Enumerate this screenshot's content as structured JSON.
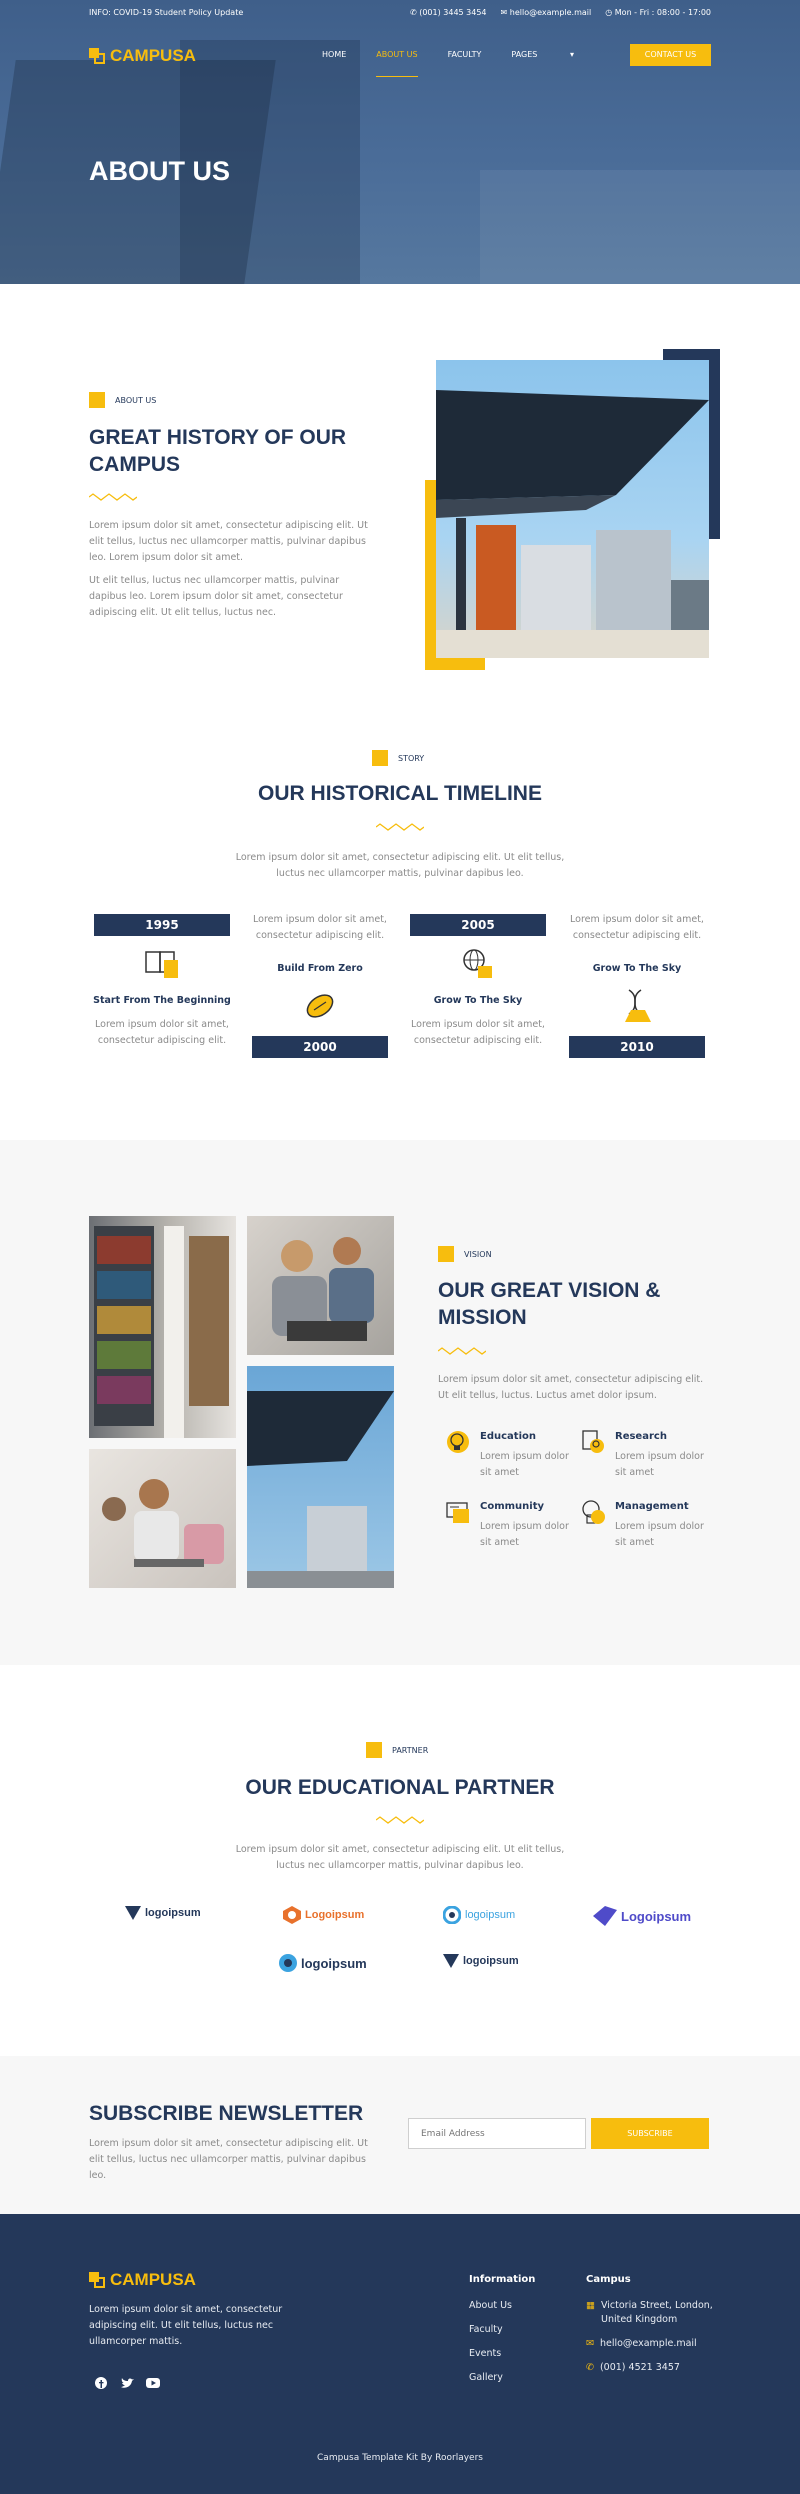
{
  "topbar": {
    "info": "INFO: COVID-19 Student Policy Update",
    "phone": "(001) 3445 3454",
    "email": "hello@example.mail",
    "hours": "Mon - Fri : 08:00 - 17:00"
  },
  "brand": {
    "name": "CAMPUSA",
    "accent": "#f7bd0e",
    "navy": "#24385a"
  },
  "nav": {
    "items": [
      "HOME",
      "ABOUT US",
      "FACULTY",
      "PAGES",
      "CONTACT US"
    ],
    "active": "ABOUT US",
    "cta": "CONTACT US"
  },
  "hero": {
    "title": "ABOUT US"
  },
  "about": {
    "tag": "ABOUT US",
    "title": "GREAT HISTORY OF OUR CAMPUS",
    "p1": "Lorem ipsum dolor sit amet, consectetur adipiscing elit. Ut elit tellus, luctus nec ullamcorper mattis, pulvinar dapibus leo. Lorem ipsum dolor sit amet.",
    "p2": "Ut elit tellus, luctus nec ullamcorper mattis, pulvinar dapibus leo. Lorem ipsum dolor sit amet, consectetur adipiscing elit. Ut elit tellus, luctus nec."
  },
  "timeline": {
    "tag": "STORY",
    "title": "OUR HISTORICAL TIMELINE",
    "intro": "Lorem ipsum dolor sit amet, consectetur adipiscing elit. Ut elit tellus, luctus nec ullamcorper mattis, pulvinar dapibus leo.",
    "items": [
      {
        "year": "1995",
        "title": "Start From The Beginning",
        "text": "Lorem ipsum dolor sit amet, consectetur adipiscing elit.",
        "icon": "book-icon"
      },
      {
        "year": "2000",
        "title": "Build From Zero",
        "text": "Lorem ipsum dolor sit amet, consectetur adipiscing elit.",
        "icon": "football-icon"
      },
      {
        "year": "2005",
        "title": "Grow To The Sky",
        "text": "Lorem ipsum dolor sit amet, consectetur adipiscing elit.",
        "icon": "globe-icon"
      },
      {
        "year": "2010",
        "title": "Grow To The Sky",
        "text": "Lorem ipsum dolor sit amet, consectetur adipiscing elit.",
        "icon": "dna-flask-icon"
      }
    ]
  },
  "vision": {
    "tag": "VISION",
    "title": "OUR GREAT VISION & MISSION",
    "intro": "Lorem ipsum dolor sit amet, consectetur adipiscing elit. Ut elit tellus, luctus. Luctus amet dolor ipsum.",
    "features": [
      {
        "title": "Education",
        "text": "Lorem ipsum dolor sit amet",
        "icon": "lightbulb-icon"
      },
      {
        "title": "Research",
        "text": "Lorem ipsum dolor sit amet",
        "icon": "research-document-icon"
      },
      {
        "title": "Community",
        "text": "Lorem ipsum dolor sit amet",
        "icon": "community-board-icon"
      },
      {
        "title": "Management",
        "text": "Lorem ipsum dolor sit amet",
        "icon": "management-head-icon"
      }
    ]
  },
  "partner": {
    "tag": "PARTNER",
    "title": "OUR EDUCATIONAL PARTNER",
    "intro": "Lorem ipsum dolor sit amet, consectetur adipiscing elit. Ut elit tellus, luctus nec ullamcorper mattis, pulvinar dapibus leo.",
    "logos": [
      "logoipsum",
      "Logoipsum",
      "logoipsum",
      "Logoipsum",
      "logoipsum",
      "logoipsum"
    ]
  },
  "subscribe": {
    "title": "SUBSCRIBE NEWSLETTER",
    "text": "Lorem ipsum dolor sit amet, consectetur adipiscing elit. Ut elit tellus, luctus nec ullamcorper mattis, pulvinar dapibus leo.",
    "placeholder": "Email Address",
    "button": "SUBSCRIBE"
  },
  "footer": {
    "about": "Lorem ipsum dolor sit amet, consectetur adipiscing elit. Ut elit tellus, luctus nec ullamcorper mattis.",
    "info_title": "Information",
    "links": [
      "About Us",
      "Faculty",
      "Events",
      "Gallery"
    ],
    "campus_title": "Campus",
    "address": "Victoria Street, London, United Kingdom",
    "email": "hello@example.mail",
    "phone": "(001) 4521 3457",
    "credit": "Campusa Template Kit By Roorlayers"
  }
}
